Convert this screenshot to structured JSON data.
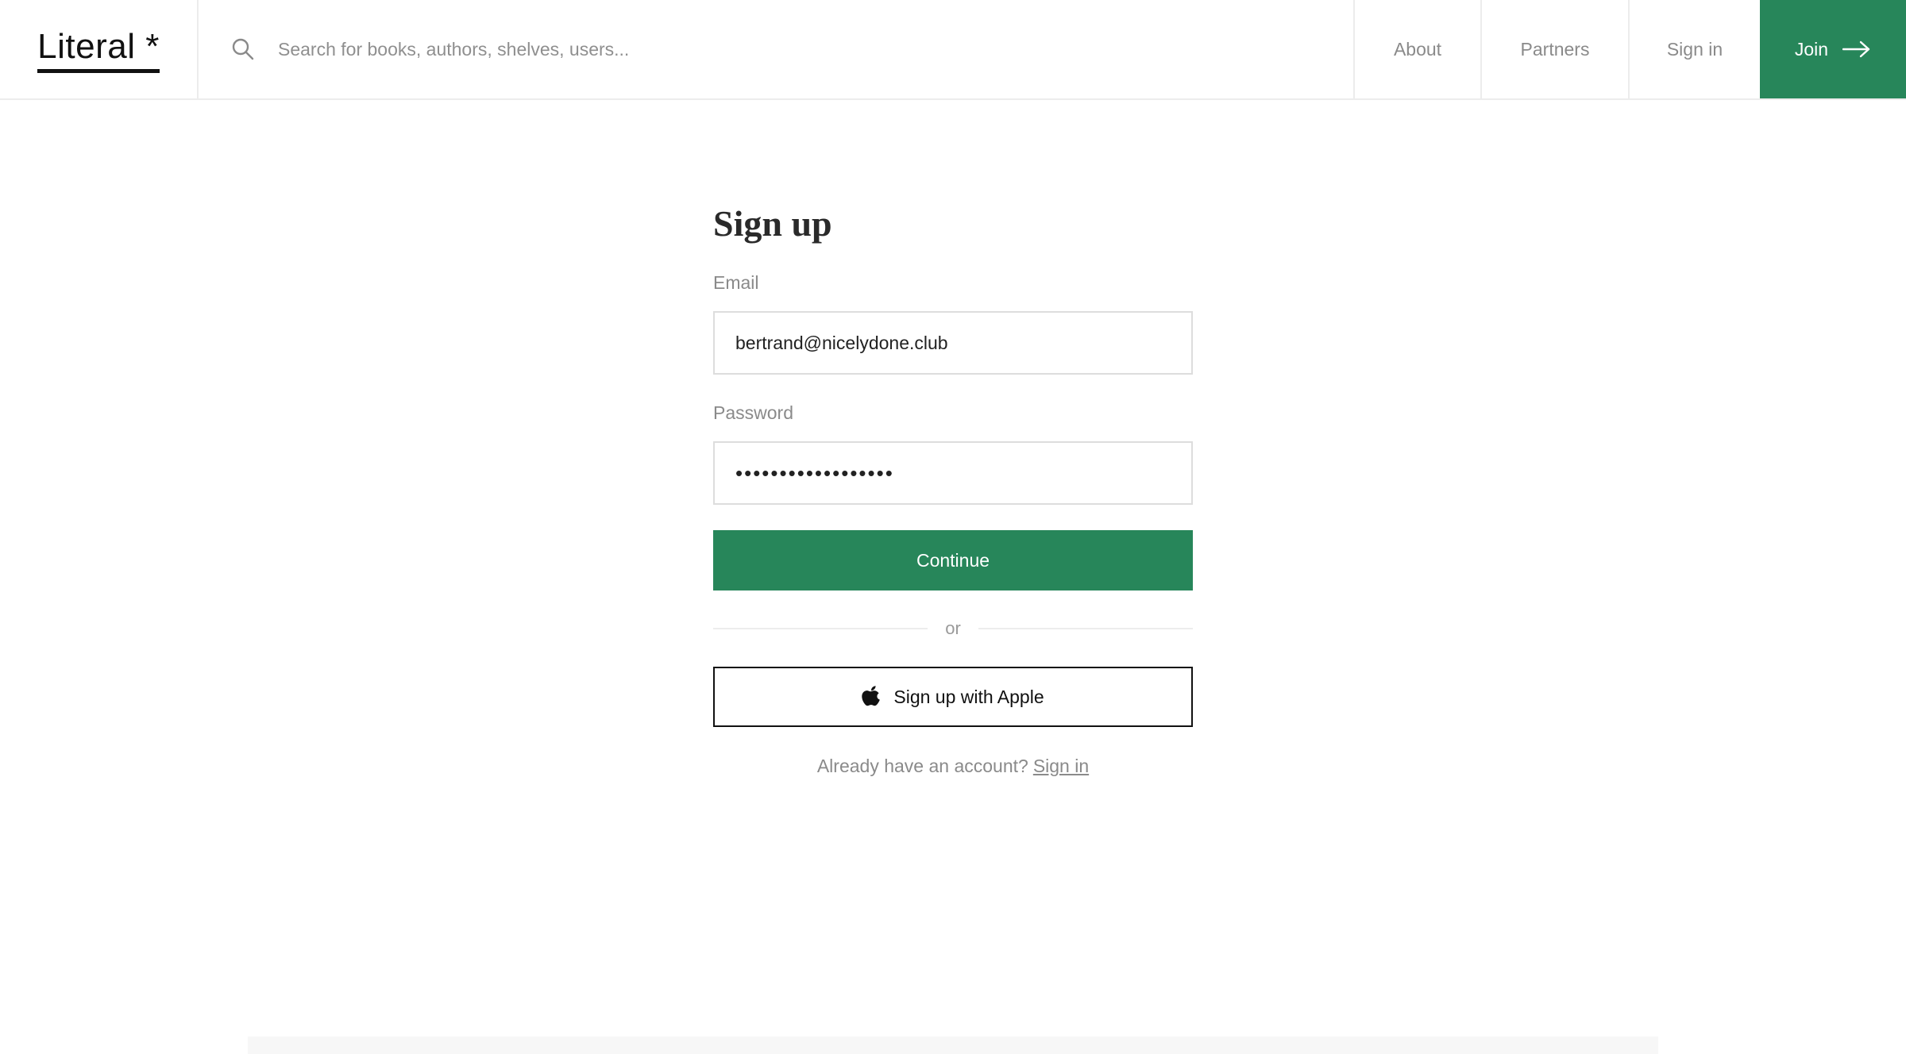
{
  "header": {
    "logo_text": "Literal *",
    "search_placeholder": "Search for books, authors, shelves, users...",
    "nav": {
      "about": "About",
      "partners": "Partners",
      "sign_in": "Sign in",
      "join": "Join"
    }
  },
  "form": {
    "title": "Sign up",
    "email_label": "Email",
    "email_value": "bertrand@nicelydone.club",
    "password_label": "Password",
    "password_value": "••••••••••••••••••",
    "continue_label": "Continue",
    "divider_text": "or",
    "apple_label": "Sign up with Apple",
    "account_prompt": "Already have an account?",
    "account_link": "Sign in"
  },
  "colors": {
    "brand_green": "#27865a",
    "muted_text": "#8a8a8a",
    "border": "#ececec"
  },
  "icons": {
    "search": "search-icon",
    "join_arrow": "arrow-right-icon",
    "apple": "apple-icon"
  }
}
